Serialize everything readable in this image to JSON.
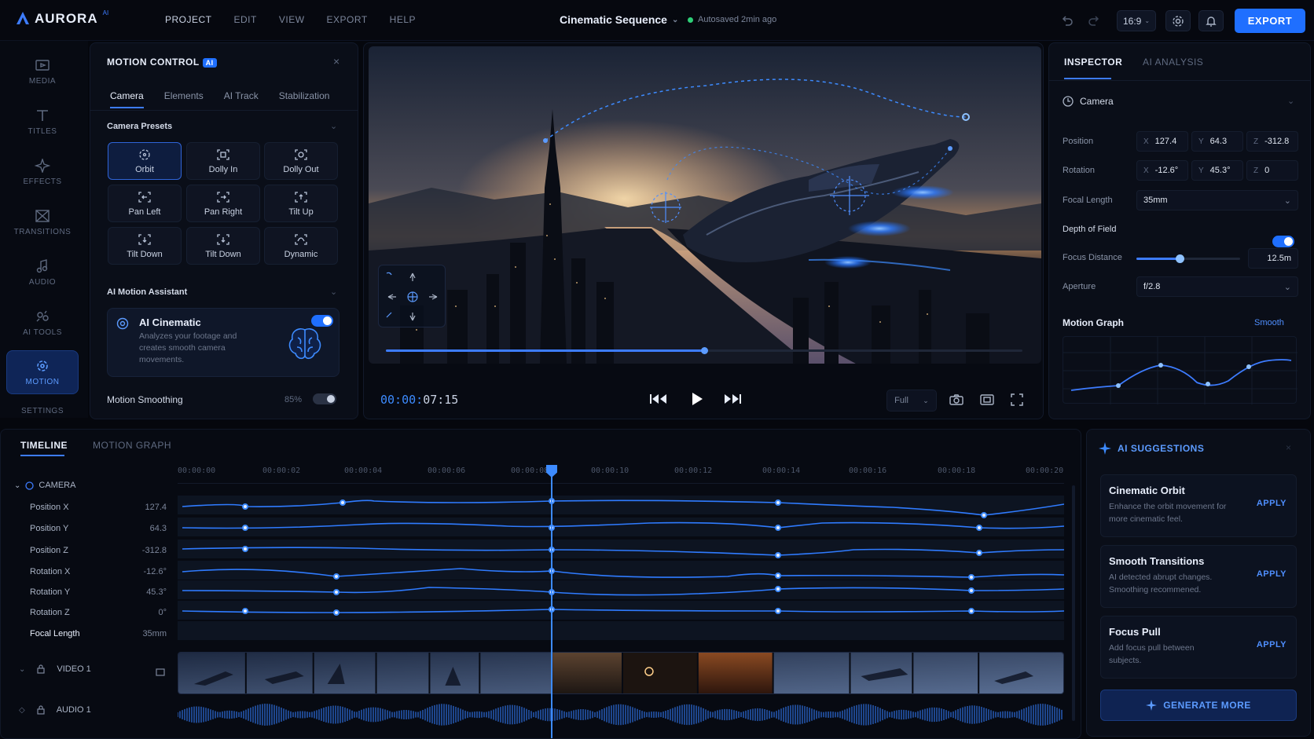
{
  "app": {
    "name": "AURORA",
    "badge": "AI"
  },
  "menu": [
    "PROJECT",
    "EDIT",
    "VIEW",
    "EXPORT",
    "HELP"
  ],
  "document": {
    "title": "Cinematic Sequence",
    "autosave": "Autosaved 2min ago"
  },
  "toolbar": {
    "aspect_ratio": "16:9",
    "export_label": "EXPORT"
  },
  "rail": [
    {
      "label": "MEDIA",
      "icon": "media-icon"
    },
    {
      "label": "TITLES",
      "icon": "titles-icon"
    },
    {
      "label": "EFFECTS",
      "icon": "effects-icon"
    },
    {
      "label": "TRANSITIONS",
      "icon": "transitions-icon"
    },
    {
      "label": "AUDIO",
      "icon": "audio-icon"
    },
    {
      "label": "AI TOOLS",
      "icon": "ai-tools-icon"
    },
    {
      "label": "MOTION",
      "icon": "motion-icon",
      "active": true
    },
    {
      "label": "SETTINGS",
      "icon": "settings-icon"
    }
  ],
  "motion_panel": {
    "title": "MOTION CONTROL",
    "badge": "AI",
    "tabs": [
      "Camera",
      "Elements",
      "AI Track",
      "Stabilization"
    ],
    "presets_heading": "Camera Presets",
    "presets": [
      "Orbit",
      "Dolly In",
      "Dolly Out",
      "Pan Left",
      "Pan Right",
      "Tilt Up",
      "Tilt Down",
      "Tilt Down",
      "Dynamic"
    ],
    "assistant_heading": "AI Motion Assistant",
    "ai_card": {
      "title": "AI Cinematic",
      "desc": "Analyzes your footage and creates smooth camera movements."
    },
    "smoothing": {
      "label": "Motion Smoothing",
      "value": "85%"
    }
  },
  "viewer": {
    "timecode_prefix": "00:00:",
    "timecode_suffix": "07:15",
    "quality": "Full",
    "scrub_progress": 0.5
  },
  "inspector": {
    "tabs": [
      "INSPECTOR",
      "AI ANALYSIS"
    ],
    "section": "Camera",
    "position": {
      "label": "Position",
      "x": "127.4",
      "y": "64.3",
      "z": "-312.8"
    },
    "rotation": {
      "label": "Rotation",
      "x": "-12.6°",
      "y": "45.3°",
      "z": "0"
    },
    "axis": {
      "x": "X",
      "y": "Y",
      "z": "Z"
    },
    "focal": {
      "label": "Focal Length",
      "value": "35mm"
    },
    "dof": {
      "label": "Depth of Field",
      "enabled": true
    },
    "focus": {
      "label": "Focus Distance",
      "value": "12.5m",
      "level": 0.42
    },
    "aperture": {
      "label": "Aperture",
      "value": "f/2.8"
    },
    "graph": {
      "label": "Motion Graph",
      "mode": "Smooth"
    }
  },
  "timeline": {
    "tabs": [
      "TIMELINE",
      "MOTION GRAPH"
    ],
    "ruler": [
      "00:00:00",
      "00:00:02",
      "00:00:04",
      "00:00:06",
      "00:00:08",
      "00:00:10",
      "00:00:12",
      "00:00:14",
      "00:00:16",
      "00:00:18",
      "00:00:20"
    ],
    "group": "CAMERA",
    "tracks": [
      {
        "label": "Position X",
        "value": "127.4"
      },
      {
        "label": "Position Y",
        "value": "64.3"
      },
      {
        "label": "Position Z",
        "value": "-312.8"
      },
      {
        "label": "Rotation X",
        "value": "-12.6°"
      },
      {
        "label": "Rotation Y",
        "value": "45.3°"
      },
      {
        "label": "Rotation Z",
        "value": "0°"
      },
      {
        "label": "Focal Length",
        "value": "35mm"
      }
    ],
    "video_track": "VIDEO 1",
    "audio_track": "AUDIO 1"
  },
  "suggestions": {
    "title": "AI SUGGESTIONS",
    "items": [
      {
        "title": "Cinematic Orbit",
        "desc": "Enhance the orbit movement for more cinematic feel.",
        "action": "APPLY"
      },
      {
        "title": "Smooth Transitions",
        "desc": "AI detected abrupt changes. Smoothing recommened.",
        "action": "APPLY"
      },
      {
        "title": "Focus Pull",
        "desc": "Add focus pull between subjects.",
        "action": "APPLY"
      }
    ],
    "generate": "GENERATE MORE"
  },
  "colors": {
    "accent": "#1f6fff",
    "accent_light": "#3d8bff",
    "bg": "#05070d",
    "panel": "#0a0e18",
    "success": "#2ecf77"
  }
}
